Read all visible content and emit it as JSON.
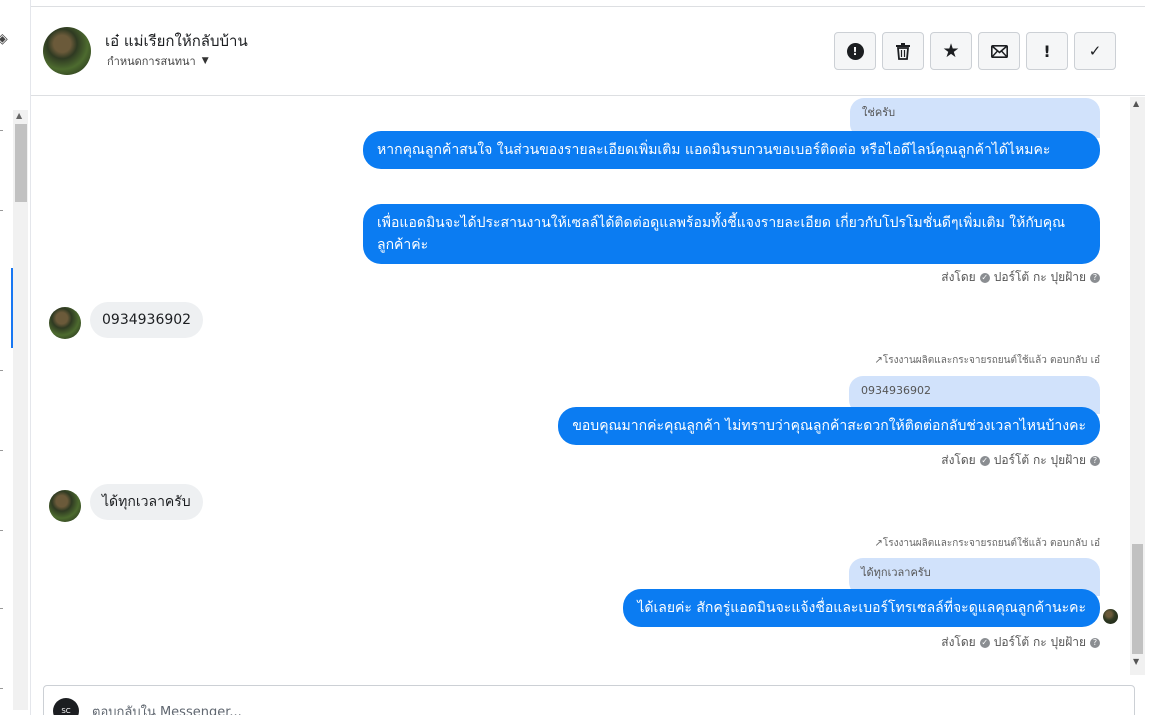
{
  "header": {
    "contact_name": "เอ๋ แม่เรียกให้กลับบ้าน",
    "assign_label": "กำหนดการสนทนา",
    "actions": {
      "spam": "alert-circle-icon",
      "delete": "trash-icon",
      "star": "star-icon",
      "mark_unread": "envelope-icon",
      "follow_up": "exclamation-icon",
      "done": "check-icon"
    }
  },
  "messages": {
    "m1_reply_quote": "ใช่ครับ",
    "m1_text": "หากคุณลูกค้าสนใจ ในส่วนของรายละเอียดเพิ่มเติม แอดมินรบกวนขอเบอร์ติดต่อ หรือไอดีไลน์คุณลูกค้าได้ไหมคะ",
    "m2_text": "เพื่อแอดมินจะได้ประสานงานให้เซลล์ได้ติดต่อดูแลพร้อมทั้งชี้แจงรายละเอียด เกี่ยวกับโปรโมชั่นดีๆเพิ่มเติม ให้กับคุณลูกค้าค่ะ",
    "sent_by_1": "ส่งโดย",
    "sender_name_1": "ปอร์โต้ กะ ปุยฝ้าย",
    "m3_incoming": "0934936902",
    "reply_hint_1": "โรงงานผลิตและกระจายรถยนต์ใช้แล้ว ตอบกลับ เอ๋",
    "m4_reply_quote": "0934936902",
    "m4_text": "ขอบคุณมากค่ะคุณลูกค้า ไม่ทราบว่าคุณลูกค้าสะดวกให้ติดต่อกลับช่วงเวลาไหนบ้างคะ",
    "sent_by_2": "ส่งโดย",
    "sender_name_2": "ปอร์โต้ กะ ปุยฝ้าย",
    "m5_incoming": "ได้ทุกเวลาครับ",
    "reply_hint_2": "โรงงานผลิตและกระจายรถยนต์ใช้แล้ว ตอบกลับ เอ๋",
    "m6_reply_quote": "ได้ทุกเวลาครับ",
    "m6_text": "ได้เลยค่ะ สักครู่แอดมินจะแจ้งชื่อและเบอร์โทรเซลล์ที่จะดูแลคุณลูกค้านะคะ",
    "sent_by_3": "ส่งโดย",
    "sender_name_3": "ปอร์โต้ กะ ปุยฝ้าย"
  },
  "composer": {
    "placeholder": "ตอบกลับใน Messenger..."
  }
}
